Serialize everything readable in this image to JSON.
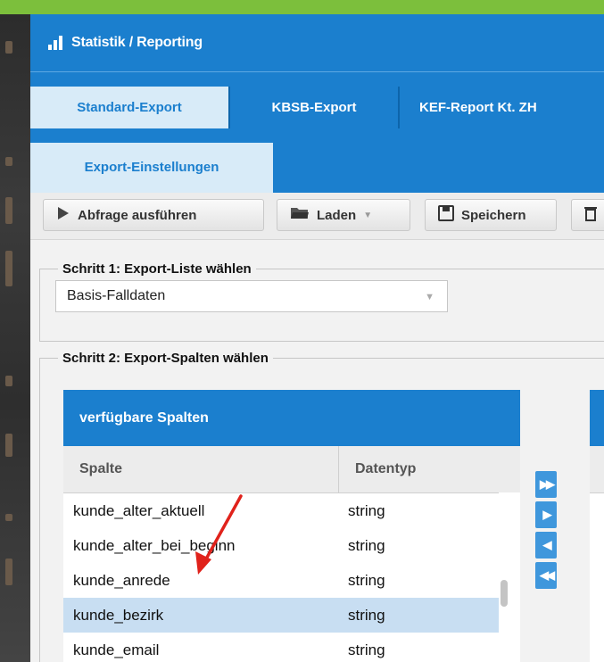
{
  "app": {
    "title": "Statistik / Reporting"
  },
  "tabs_level1": [
    {
      "label": "Standard-Export",
      "active": true
    },
    {
      "label": "KBSB-Export",
      "active": false
    },
    {
      "label": "KEF-Report Kt. ZH",
      "active": false
    }
  ],
  "tabs_level2": [
    {
      "label": "Export-Einstellungen",
      "active": true
    }
  ],
  "toolbar": {
    "run_label": "Abfrage ausführen",
    "load_label": "Laden",
    "save_label": "Speichern"
  },
  "step1": {
    "legend": "Schritt 1: Export-Liste wählen",
    "selected": "Basis-Falldaten"
  },
  "step2": {
    "legend": "Schritt 2: Export-Spalten wählen",
    "available": {
      "title": "verfügbare Spalten",
      "columns": [
        "Spalte",
        "Datentyp"
      ],
      "rows": [
        {
          "spalte": "kunde_alter_aktuell",
          "datentyp": "string",
          "selected": false
        },
        {
          "spalte": "kunde_alter_bei_beginn",
          "datentyp": "string",
          "selected": false
        },
        {
          "spalte": "kunde_anrede",
          "datentyp": "string",
          "selected": false
        },
        {
          "spalte": "kunde_bezirk",
          "datentyp": "string",
          "selected": true
        },
        {
          "spalte": "kunde_email",
          "datentyp": "string",
          "selected": false
        }
      ]
    }
  },
  "colors": {
    "header_blue": "#1b7fce",
    "accent_green": "#7cbf3c",
    "selected_row": "#c8def2",
    "annotation_arrow": "#e0221b"
  }
}
